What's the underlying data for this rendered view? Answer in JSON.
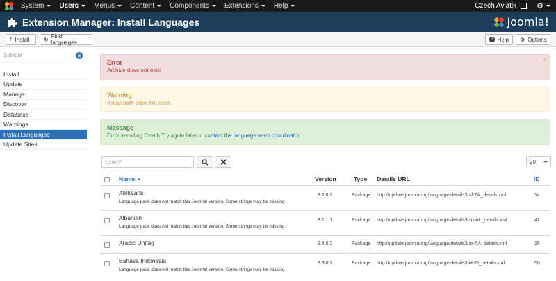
{
  "topnav": {
    "menus": [
      {
        "label": "System",
        "active": false
      },
      {
        "label": "Users",
        "active": true
      },
      {
        "label": "Menus",
        "active": false
      },
      {
        "label": "Content",
        "active": false
      },
      {
        "label": "Components",
        "active": false
      },
      {
        "label": "Extensions",
        "active": false
      },
      {
        "label": "Help",
        "active": false
      }
    ],
    "site_name": "Czech Aviatik",
    "icons": [
      "joomla-logo-icon",
      "external-link-icon",
      "gear-icon",
      "caret-down-icon"
    ]
  },
  "header": {
    "title": "Extension Manager: Install Languages",
    "brand": "Joomla!",
    "bg_color": "#1c3d5a"
  },
  "toolbar": {
    "install_label": "Install",
    "find_languages_label": "Find languages",
    "help_label": "Help",
    "options_label": "Options"
  },
  "sidebar": {
    "heading": "Sidebar",
    "items": [
      {
        "label": "Install"
      },
      {
        "label": "Update"
      },
      {
        "label": "Manage"
      },
      {
        "label": "Discover"
      },
      {
        "label": "Database"
      },
      {
        "label": "Warnings"
      },
      {
        "label": "Install Languages"
      },
      {
        "label": "Update Sites"
      }
    ],
    "active_item": "Install Languages",
    "accent": "#2f70b6"
  },
  "alerts": {
    "error": {
      "title": "Error",
      "body": "Archive does not exist",
      "close": "×"
    },
    "warning": {
      "title": "Warning",
      "body": "Install path does not exist."
    },
    "message": {
      "title": "Message",
      "body_prefix": "Error installing Czech Try again later or ",
      "link": "contact the language team coordinator"
    }
  },
  "filter": {
    "search_placeholder": "Search",
    "limit": "20"
  },
  "table": {
    "headers": {
      "name": "Name",
      "version": "Version",
      "type": "Type",
      "url": "Details URL",
      "id": "ID"
    },
    "rows": [
      {
        "name": "Afrikaans",
        "note": "Language pack does not match this Joomla! version. Some strings may be missing.",
        "version": "3.2.0.2",
        "type": "Package",
        "url": "http://update.joomla.org/language/details3/af-ZA_details.xml",
        "id": "14"
      },
      {
        "name": "Albanian",
        "note": "Language pack does not match this Joomla! version. Some strings may be missing.",
        "version": "3.1.1.1",
        "type": "Package",
        "url": "http://update.joomla.org/language/details3/sq-AL_details.xml",
        "id": "42"
      },
      {
        "name": "Arabic Unitag",
        "note": "",
        "version": "3.4.0.2",
        "type": "Package",
        "url": "http://update.joomla.org/language/details3/ar-AA_details.xml",
        "id": "15"
      },
      {
        "name": "Bahasa Indonesia",
        "note": "Language pack does not match this Joomla! version. Some strings may be missing.",
        "version": "3.3.0.2",
        "type": "Package",
        "url": "http://update.joomla.org/language/details3/id-ID_details.xml",
        "id": "50"
      }
    ]
  }
}
